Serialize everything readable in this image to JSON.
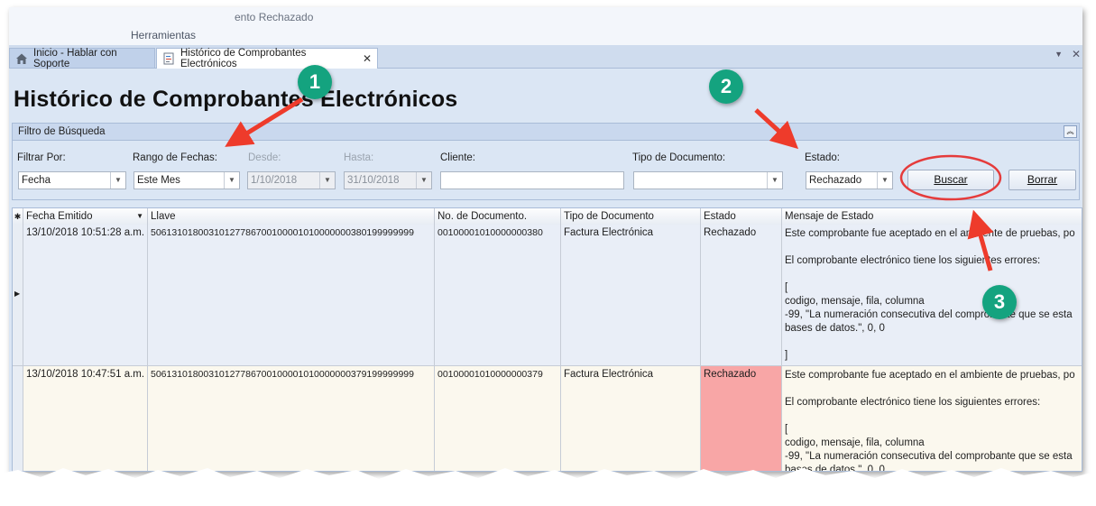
{
  "ribbon": {
    "group1": "ento Rechazado",
    "group2": "Herramientas"
  },
  "tabs": [
    {
      "label": "Inicio - Hablar con Soporte",
      "icon": "home-icon",
      "active": false
    },
    {
      "label": "Histórico de Comprobantes Electrónicos",
      "icon": "document-icon",
      "active": true
    }
  ],
  "page": {
    "title": "Histórico de Comprobantes Electrónicos"
  },
  "filter": {
    "header": "Filtro de Búsqueda",
    "filtrar_por_label": "Filtrar Por:",
    "filtrar_por_value": "Fecha",
    "rango_label": "Rango de Fechas:",
    "rango_value": "Este Mes",
    "desde_label": "Desde:",
    "desde_value": "1/10/2018",
    "hasta_label": "Hasta:",
    "hasta_value": "31/10/2018",
    "cliente_label": "Cliente:",
    "cliente_value": "",
    "tipo_label": "Tipo de Documento:",
    "tipo_value": "",
    "estado_label": "Estado:",
    "estado_value": "Rechazado",
    "buscar_label": "Buscar",
    "borrar_label": "Borrar"
  },
  "grid": {
    "columns": [
      "Fecha Emitido",
      "Llave",
      "No. de Documento.",
      "Tipo de Documento",
      "Estado",
      "Mensaje de Estado"
    ],
    "rows": [
      {
        "fecha": "13/10/2018 10:51:28 a.m.",
        "llave": "50613101800310127786700100001010000000380199999999",
        "numero": "00100001010000000380",
        "tipo": "Factura Electrónica",
        "estado": "Rechazado",
        "mensaje": [
          "Este comprobante fue aceptado en el ambiente de pruebas, po",
          "",
          "El comprobante electrónico tiene los siguientes errores:",
          "",
          "[",
          "codigo, mensaje, fila, columna",
          "-99, \"La numeración consecutiva del comprobante que se esta",
          "bases de datos.\", 0, 0",
          "",
          "]"
        ]
      },
      {
        "fecha": "13/10/2018 10:47:51 a.m.",
        "llave": "50613101800310127786700100001010000000379199999999",
        "numero": "00100001010000000379",
        "tipo": "Factura Electrónica",
        "estado": "Rechazado",
        "mensaje": [
          "Este comprobante fue aceptado en el ambiente de pruebas, po",
          "",
          "El comprobante electrónico tiene los siguientes errores:",
          "",
          "[",
          "codigo, mensaje, fila, columna",
          "-99, \"La numeración consecutiva del comprobante que se esta",
          "bases de datos.\", 0, 0"
        ]
      }
    ]
  },
  "callouts": [
    "1",
    "2",
    "3"
  ],
  "colors": {
    "callout": "#14a37f",
    "arrow": "#ee3b2b",
    "rejected": "#f8a6a6",
    "row1": "#e9eef7",
    "row2": "#fbf8ee"
  }
}
